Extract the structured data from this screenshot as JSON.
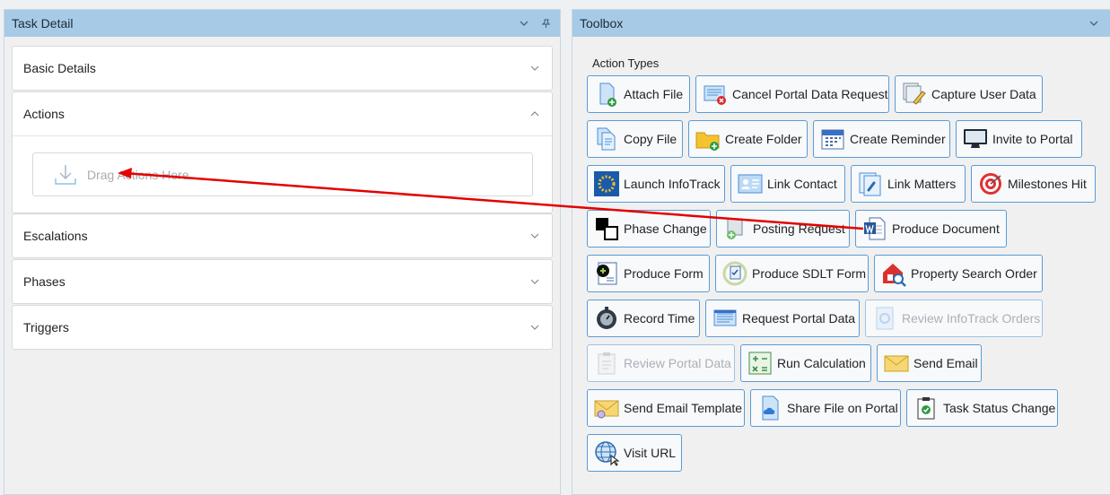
{
  "task_detail": {
    "title": "Task Detail",
    "sections": {
      "basic": "Basic Details",
      "actions": "Actions",
      "escalations": "Escalations",
      "phases": "Phases",
      "triggers": "Triggers"
    },
    "drop_text": "Drag Actions Here"
  },
  "toolbox": {
    "title": "Toolbox",
    "section_label": "Action Types",
    "actions": [
      {
        "label": "Attach File",
        "icon": "attach-file-icon",
        "enabled": true
      },
      {
        "label": "Cancel Portal Data Request",
        "icon": "cancel-portal-icon",
        "enabled": true
      },
      {
        "label": "Capture User Data",
        "icon": "capture-data-icon",
        "enabled": true
      },
      {
        "label": "Copy File",
        "icon": "copy-file-icon",
        "enabled": true
      },
      {
        "label": "Create Folder",
        "icon": "folder-icon",
        "enabled": true
      },
      {
        "label": "Create Reminder",
        "icon": "calendar-icon",
        "enabled": true
      },
      {
        "label": "Invite to Portal",
        "icon": "monitor-icon",
        "enabled": true
      },
      {
        "label": "Launch InfoTrack",
        "icon": "infotrack-icon",
        "enabled": true
      },
      {
        "label": "Link Contact",
        "icon": "contact-card-icon",
        "enabled": true
      },
      {
        "label": "Link Matters",
        "icon": "link-icon",
        "enabled": true
      },
      {
        "label": "Milestones Hit",
        "icon": "target-icon",
        "enabled": true
      },
      {
        "label": "Phase Change",
        "icon": "phase-squares-icon",
        "enabled": true
      },
      {
        "label": "Posting Request",
        "icon": "posting-icon",
        "enabled": true
      },
      {
        "label": "Produce Document",
        "icon": "word-document-icon",
        "enabled": true
      },
      {
        "label": "Produce Form",
        "icon": "form-icon",
        "enabled": true
      },
      {
        "label": "Produce SDLT Form",
        "icon": "sdlt-form-icon",
        "enabled": true
      },
      {
        "label": "Property Search Order",
        "icon": "house-search-icon",
        "enabled": true
      },
      {
        "label": "Record Time",
        "icon": "stopwatch-icon",
        "enabled": true
      },
      {
        "label": "Request Portal Data",
        "icon": "portal-data-icon",
        "enabled": true
      },
      {
        "label": "Review InfoTrack Orders",
        "icon": "review-orders-icon",
        "enabled": false
      },
      {
        "label": "Review Portal Data",
        "icon": "clipboard-icon",
        "enabled": false
      },
      {
        "label": "Run Calculation",
        "icon": "calculator-icon",
        "enabled": true
      },
      {
        "label": "Send Email",
        "icon": "envelope-icon",
        "enabled": true
      },
      {
        "label": "Send Email Template",
        "icon": "email-template-icon",
        "enabled": true
      },
      {
        "label": "Share File on Portal",
        "icon": "cloud-file-icon",
        "enabled": true
      },
      {
        "label": "Task Status Change",
        "icon": "clipboard-check-icon",
        "enabled": true
      },
      {
        "label": "Visit URL",
        "icon": "globe-icon",
        "enabled": true
      }
    ]
  },
  "colors": {
    "header": "#a7cbe6",
    "button_border": "#5b9bd5",
    "arrow": "#e30000"
  }
}
